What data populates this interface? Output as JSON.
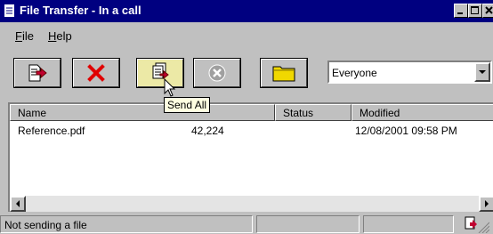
{
  "window": {
    "title": "File Transfer - In a call"
  },
  "menu": {
    "items": [
      {
        "label": "File",
        "mnemonic": "F",
        "rest": "ile"
      },
      {
        "label": "Help",
        "mnemonic": "H",
        "rest": "elp"
      }
    ]
  },
  "toolbar": {
    "buttons": [
      {
        "name": "send-file",
        "icon": "send-file-icon"
      },
      {
        "name": "cancel-transfer",
        "icon": "red-x-icon"
      },
      {
        "name": "send-all",
        "icon": "send-all-icon"
      },
      {
        "name": "stop",
        "icon": "stop-icon"
      },
      {
        "name": "open-folder",
        "icon": "folder-icon"
      }
    ],
    "recipient": {
      "selected": "Everyone"
    }
  },
  "tooltip": {
    "text": "Send All"
  },
  "list": {
    "columns": [
      "Name",
      "Status",
      "Modified"
    ],
    "rows": [
      {
        "name": "Reference.pdf",
        "size": "42,224",
        "modified": "12/08/2001  09:58 PM"
      }
    ]
  },
  "status": {
    "text": "Not sending a file"
  },
  "colors": {
    "titlebar": "#000080",
    "face": "#c0c0c0",
    "tooltip": "#ffffe1",
    "cancel_red": "#e00000"
  }
}
